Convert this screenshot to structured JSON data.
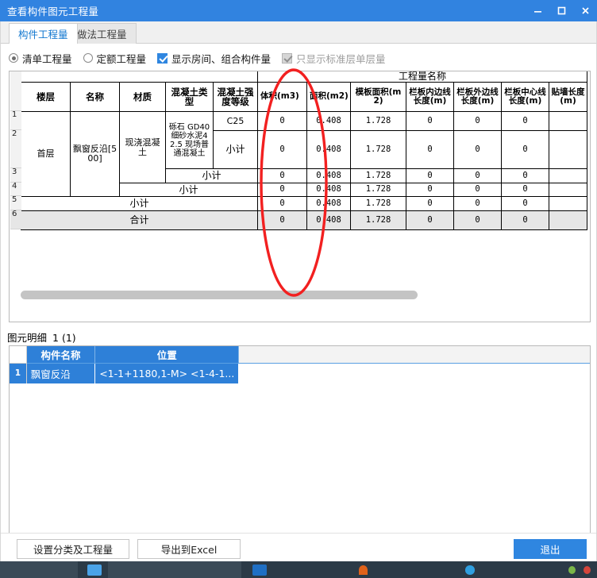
{
  "window": {
    "title": "查看构件图元工程量",
    "minimize_label": "minimize",
    "maximize_label": "maximize",
    "close_label": "close",
    "titlebar_color": "#3183e0"
  },
  "tabs": [
    {
      "label": "构件工程量",
      "active": true
    },
    {
      "label": "做法工程量",
      "active": false
    }
  ],
  "options": {
    "radios": [
      {
        "label": "清单工程量",
        "checked": true
      },
      {
        "label": "定额工程量",
        "checked": false
      }
    ],
    "checkboxes": [
      {
        "label": "显示房间、组合构件量",
        "checked": true,
        "disabled": false
      },
      {
        "label": "只显示标准层单层量",
        "checked": true,
        "disabled": true
      }
    ]
  },
  "qty_table": {
    "group_header": "工程量名称",
    "columns": [
      "楼层",
      "名称",
      "材质",
      "混凝土类型",
      "混凝土强度等级",
      "体积(m3)",
      "面积(m2)",
      "模板面积(m2)",
      "栏板内边线长度(m)",
      "栏板外边线长度(m)",
      "栏板中心线长度(m)",
      "贴墙长度(m)"
    ],
    "floor": "首层",
    "name": "飘窗反沿[500]",
    "material": "现浇混凝土",
    "concrete_type": "砾石 GD40 细砂水泥42.5 现场普通混凝土",
    "grade": "C25",
    "subtotal_label": "小计",
    "total_label": "合计",
    "row_numbers": [
      "1",
      "2",
      "3",
      "4",
      "5",
      "6"
    ],
    "rows": [
      {
        "n": "1",
        "values": [
          "0",
          "0.408",
          "1.728",
          "0",
          "0",
          "0",
          ""
        ],
        "bold": false
      },
      {
        "n": "2",
        "values": [
          "0",
          "0.408",
          "1.728",
          "0",
          "0",
          "0",
          ""
        ],
        "bold": true
      },
      {
        "n": "3",
        "values": [
          "0",
          "0.408",
          "1.728",
          "0",
          "0",
          "0",
          ""
        ],
        "bold": true
      },
      {
        "n": "4",
        "values": [
          "0",
          "0.408",
          "1.728",
          "0",
          "0",
          "0",
          ""
        ],
        "bold": true
      },
      {
        "n": "5",
        "values": [
          "0",
          "0.408",
          "1.728",
          "0",
          "0",
          "0",
          ""
        ],
        "bold": true
      },
      {
        "n": "6",
        "values": [
          "0",
          "0.408",
          "1.728",
          "0",
          "0",
          "0",
          ""
        ],
        "bold": false
      }
    ]
  },
  "detail": {
    "label": "图元明细",
    "count": "1 (1)",
    "columns": [
      "构件名称",
      "位置"
    ],
    "rows": [
      {
        "index": "1",
        "name": "飘窗反沿",
        "position": "<1-1+1180,1-M> <1-4-1..."
      }
    ]
  },
  "buttons": {
    "set_class": "设置分类及工程量",
    "export_excel": "导出到Excel",
    "exit": "退出"
  },
  "annotation": {
    "shape": "red-ellipse",
    "color": "#f22020",
    "target_column": "体积(m3)"
  }
}
